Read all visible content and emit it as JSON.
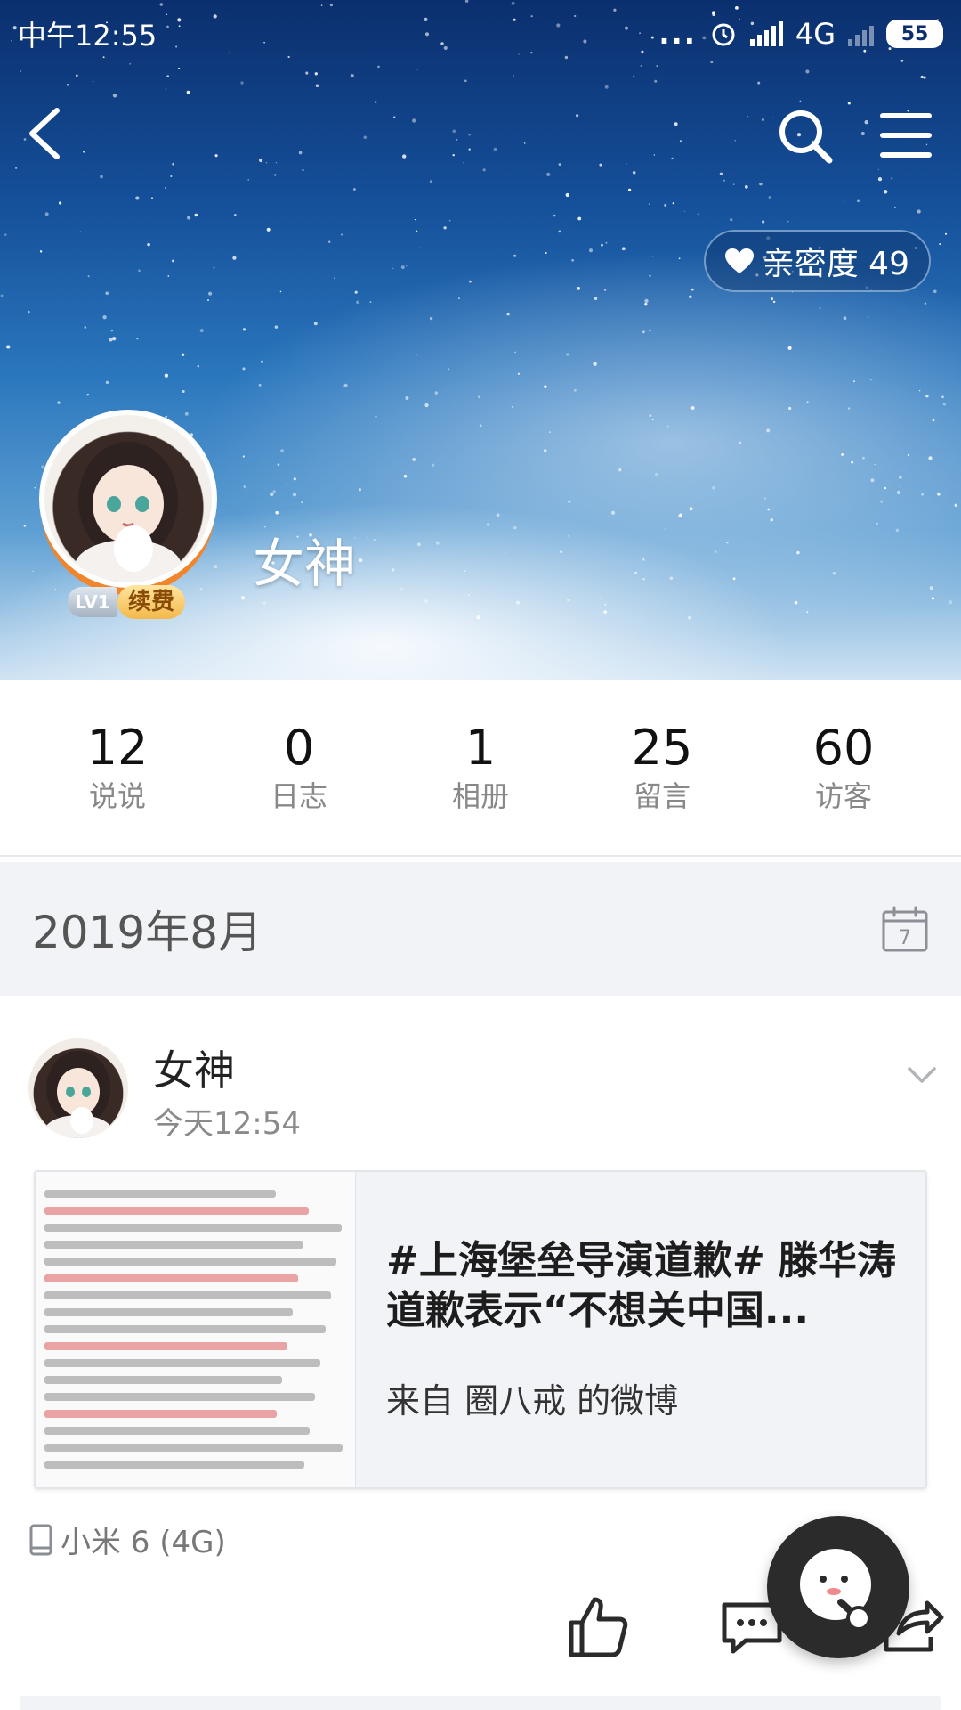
{
  "status_bar": {
    "time": "中午12:55",
    "dots": "...",
    "network": "4G",
    "battery": "55"
  },
  "nav": {
    "back_icon": "chevron-left-icon",
    "search_icon": "search-icon",
    "menu_icon": "hamburger-menu-icon"
  },
  "profile": {
    "name": "女神",
    "intimacy_label": "亲密度 49",
    "level": "LV1",
    "renew_label": "续费"
  },
  "stats": [
    {
      "value": "12",
      "label": "说说"
    },
    {
      "value": "0",
      "label": "日志"
    },
    {
      "value": "1",
      "label": "相册"
    },
    {
      "value": "25",
      "label": "留言"
    },
    {
      "value": "60",
      "label": "访客"
    }
  ],
  "timeline": {
    "month": "2019年8月",
    "calendar_day": "7"
  },
  "post": {
    "author": "女神",
    "time": "今天12:54",
    "share_title": "#上海堡垒导演道歉# 滕华涛道歉表示“不想关中国...",
    "share_source": "来自 圈八戒 的微博",
    "device": "小米 6 (4G)"
  },
  "colors": {
    "accent_orange": "#f2852a",
    "sky_dark": "#0b2f6e",
    "band_gray": "#f2f3f7"
  }
}
